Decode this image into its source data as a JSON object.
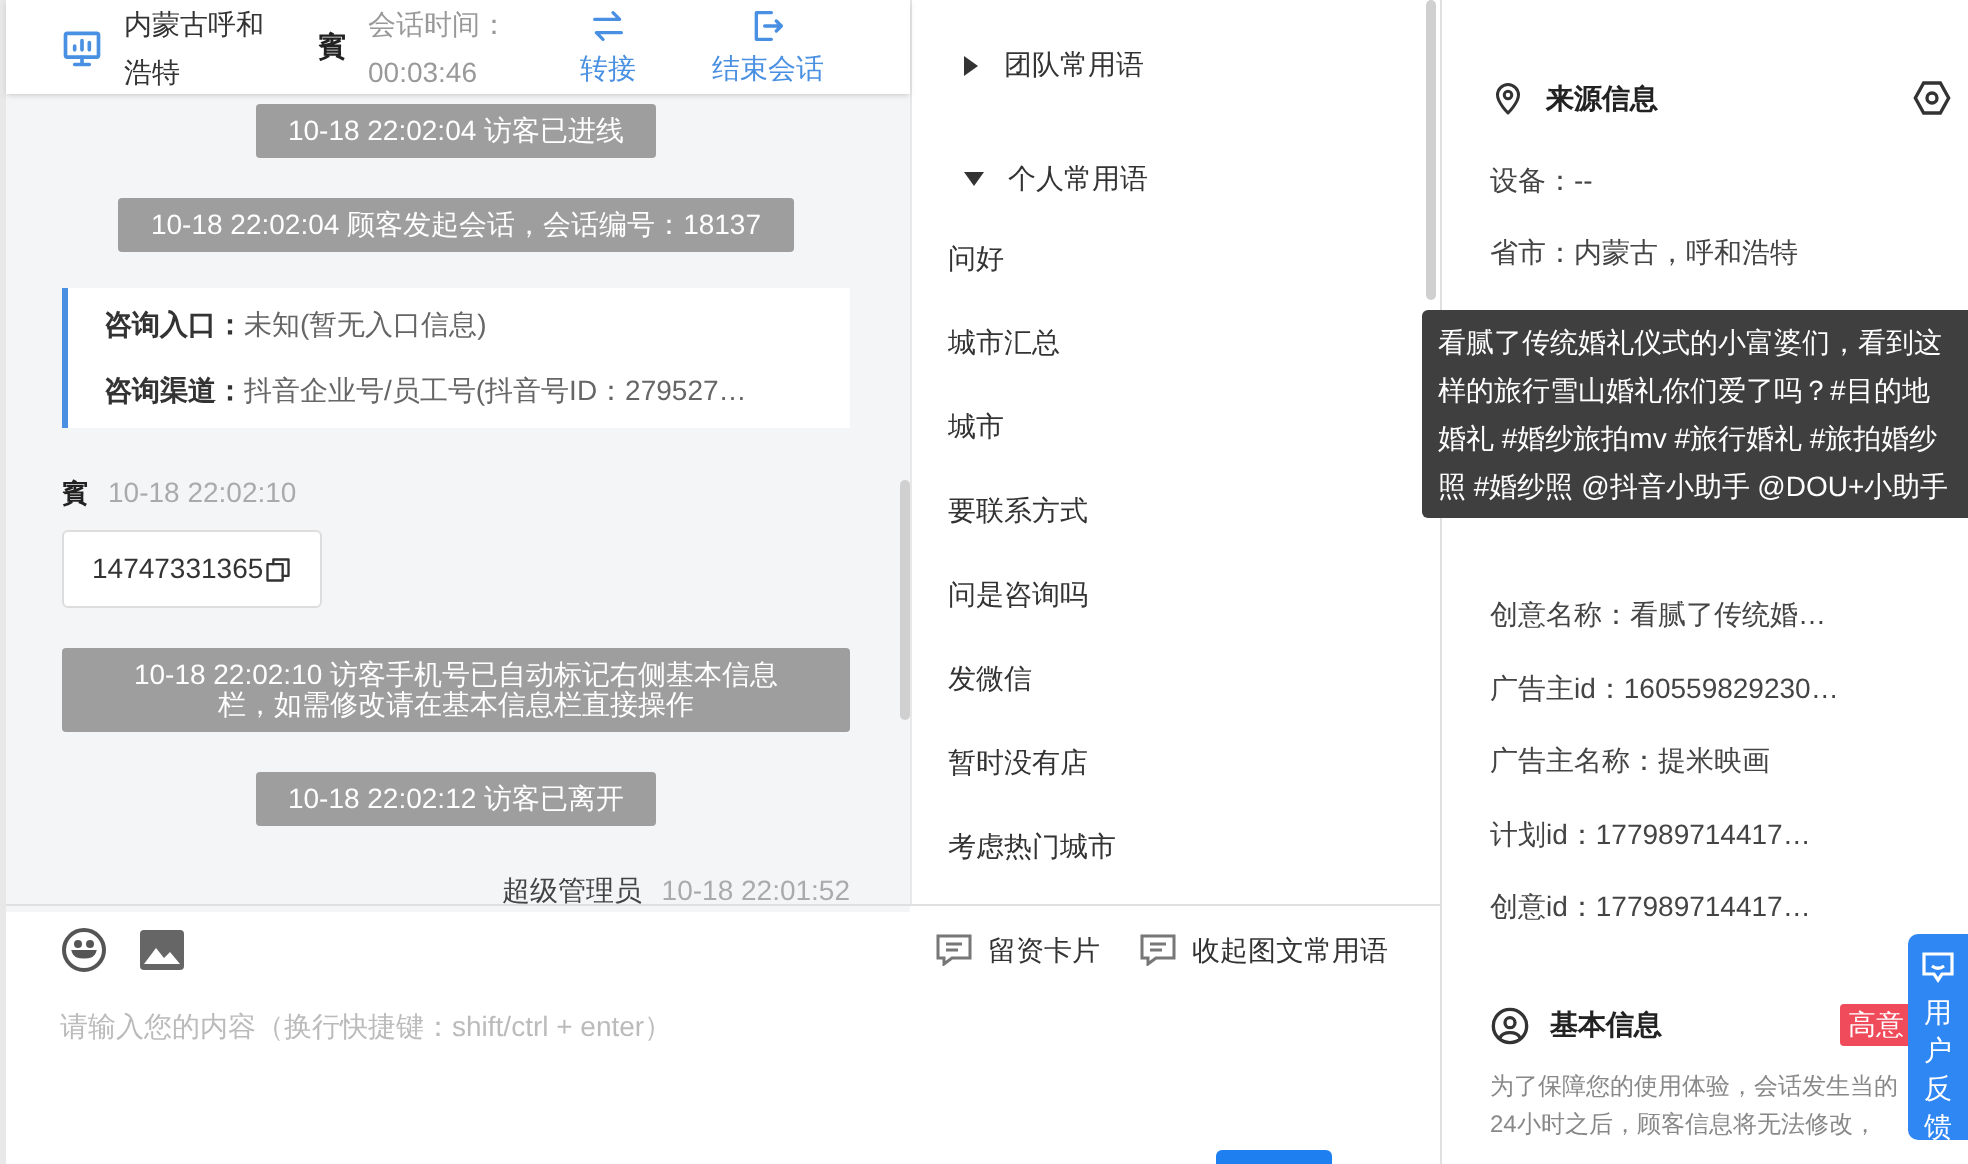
{
  "header": {
    "location": "内蒙古呼和浩特",
    "visitor_mark": "賓",
    "timer_label": "会话时间：",
    "timer": "00:03:46",
    "actions": [
      {
        "label": "转接",
        "kind": "transfer"
      },
      {
        "label": "结束会话",
        "kind": "end"
      }
    ]
  },
  "messages": [
    {
      "kind": "system",
      "text": "10-18 22:02:04 访客已进线"
    },
    {
      "kind": "system",
      "text": "10-18 22:02:04 顾客发起会话，会话编号：18137"
    },
    {
      "kind": "info",
      "lines": [
        {
          "label": "咨询入口：",
          "value": "未知(暂无入口信息)"
        },
        {
          "label": "咨询渠道：",
          "value": "抖音企业号/员工号(抖音号ID：279527…"
        }
      ]
    },
    {
      "kind": "visitor",
      "sender": "賓",
      "time": "10-18 22:02:10",
      "text": "14747331365"
    },
    {
      "kind": "system",
      "text": "10-18 22:02:10 访客手机号已自动标记右侧基本信息栏，如需修改请在基本信息栏直接操作"
    },
    {
      "kind": "system",
      "text": "10-18 22:02:12 访客已离开"
    },
    {
      "kind": "agent",
      "sender": "超级管理员",
      "time": "10-18 22:01:52"
    }
  ],
  "phrases": [
    {
      "label": "团队常用语",
      "expanded": false
    },
    {
      "label": "个人常用语",
      "expanded": true,
      "children": [
        {
          "label": "问好"
        },
        {
          "label": "城市汇总"
        },
        {
          "label": "城市"
        },
        {
          "label": "要联系方式"
        },
        {
          "label": "问是咨询吗"
        },
        {
          "label": "发微信"
        },
        {
          "label": "暂时没有店"
        },
        {
          "label": "考虑热门城市"
        }
      ]
    }
  ],
  "composer": {
    "actions": [
      {
        "label": "留资卡片"
      },
      {
        "label": "收起图文常用语"
      }
    ],
    "placeholder": "请输入您的内容（换行快捷键：shift/ctrl + enter）"
  },
  "source_info": {
    "title": "来源信息",
    "rows_top": [
      "设备：--",
      "省市：内蒙古，呼和浩特"
    ],
    "rows_bottom": [
      "创意名称：看腻了传统婚…",
      "广告主id：160559829230…",
      "广告主名称：提米映画",
      "计划id：177989714417…",
      "创意id：177989714417…"
    ],
    "tooltip": "看腻了传统婚礼仪式的小富婆们，看到这样的旅行雪山婚礼你们爱了吗？#目的地婚礼 #婚纱旅拍mv #旅行婚礼 #旅拍婚纱照 #婚纱照 @抖音小助手 @DOU+小助手"
  },
  "basic_info": {
    "title": "基本信息",
    "badge": "高意",
    "notice": "为了保障您的使用体验，会话发生当的24小时之后，顾客信息将无法修改，"
  },
  "feedback": {
    "label": "用户反馈"
  }
}
